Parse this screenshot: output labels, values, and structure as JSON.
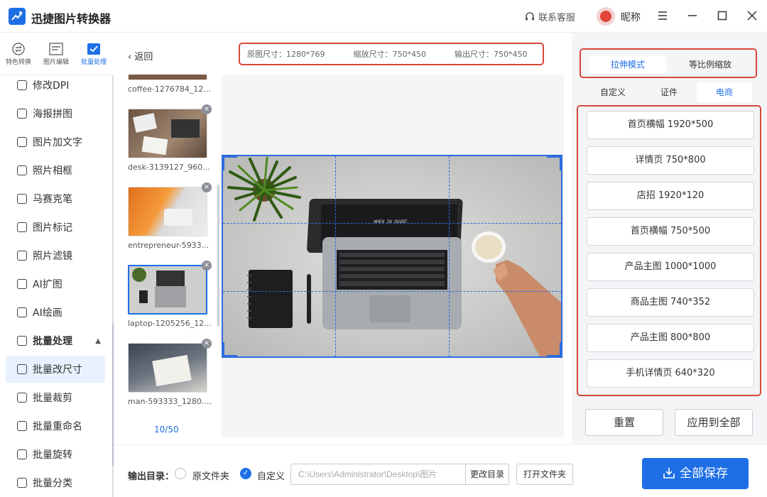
{
  "app": {
    "title": "迅捷图片转换器"
  },
  "header": {
    "service_label": "联系客服",
    "nickname": "昵称"
  },
  "top_tabs": [
    {
      "label": "特色转换",
      "icon": "swap-icon"
    },
    {
      "label": "图片编辑",
      "icon": "image-edit-icon"
    },
    {
      "label": "批量处理",
      "icon": "batch-icon"
    }
  ],
  "sidebar": {
    "items": [
      {
        "label": "修改DPI"
      },
      {
        "label": "海报拼图"
      },
      {
        "label": "图片加文字"
      },
      {
        "label": "照片相框"
      },
      {
        "label": "马赛克笔"
      },
      {
        "label": "图片标记"
      },
      {
        "label": "照片滤镜"
      },
      {
        "label": "AI扩图"
      },
      {
        "label": "AI绘画"
      },
      {
        "label": "批量处理",
        "group": true
      },
      {
        "label": "批量改尺寸",
        "active": true
      },
      {
        "label": "批量裁剪"
      },
      {
        "label": "批量重命名"
      },
      {
        "label": "批量旋转"
      },
      {
        "label": "批量分类"
      }
    ]
  },
  "files": {
    "back_label": "返回",
    "items": [
      {
        "name": "coffee-1276784_12..."
      },
      {
        "name": "desk-3139127_960..."
      },
      {
        "name": "entrepreneur-5933..."
      },
      {
        "name": "laptop-1205256_12...",
        "selected": true
      },
      {
        "name": "man-593333_1280...."
      }
    ],
    "counter": "10/50"
  },
  "size_info": {
    "original": "原图尺寸：1280*769",
    "scaled": "缩放尺寸：750*450",
    "output": "输出尺寸：750*450"
  },
  "modes": {
    "stretch": "拉伸模式",
    "proportional": "等比例缩放"
  },
  "sub_tabs": {
    "custom": "自定义",
    "id_photo": "证件",
    "ecommerce": "电商"
  },
  "presets": [
    "首页横幅 1920*500",
    "详情页 750*800",
    "店招 1920*120",
    "首页横幅 750*500",
    "产品主图 1000*1000",
    "商品主图 740*352",
    "产品主图 800*800",
    "手机详情页 640*320"
  ],
  "actions": {
    "reset": "重置",
    "apply_all": "应用到全部"
  },
  "output": {
    "label": "输出目录：",
    "option_original": "原文件夹",
    "option_custom": "自定义",
    "path": "C:\\Users\\Administrator\\Desktop\\图片",
    "change_dir": "更改目录",
    "open_folder": "打开文件夹",
    "save_all": "全部保存"
  },
  "colors": {
    "accent": "#1e6fe6",
    "highlight": "#d6473a"
  }
}
